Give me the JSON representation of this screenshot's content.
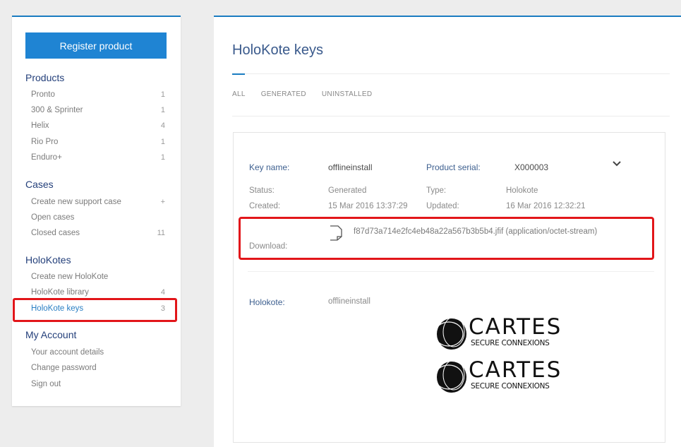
{
  "sidebar": {
    "register_label": "Register product",
    "sections": {
      "products": {
        "title": "Products",
        "items": [
          {
            "label": "Pronto",
            "count": "1"
          },
          {
            "label": "300 & Sprinter",
            "count": "1"
          },
          {
            "label": "Helix",
            "count": "4"
          },
          {
            "label": "Rio Pro",
            "count": "1"
          },
          {
            "label": "Enduro+",
            "count": "1"
          }
        ]
      },
      "cases": {
        "title": "Cases",
        "items": [
          {
            "label": "Create new support case",
            "count": "+"
          },
          {
            "label": "Open cases",
            "count": ""
          },
          {
            "label": "Closed cases",
            "count": "11"
          }
        ]
      },
      "holokotes": {
        "title": "HoloKotes",
        "items": [
          {
            "label": "Create new HoloKote",
            "count": ""
          },
          {
            "label": "HoloKote library",
            "count": "4"
          },
          {
            "label": "HoloKote keys",
            "count": "3"
          }
        ]
      },
      "account": {
        "title": "My Account",
        "items": [
          {
            "label": "Your account details"
          },
          {
            "label": "Change password"
          },
          {
            "label": "Sign out"
          }
        ]
      }
    }
  },
  "main": {
    "title": "HoloKote keys",
    "tabs": [
      "ALL",
      "GENERATED",
      "UNINSTALLED"
    ],
    "key": {
      "key_name_label": "Key name:",
      "key_name": "offlineinstall",
      "serial_label": "Product serial:",
      "serial": "X000003",
      "status_label": "Status:",
      "status": "Generated",
      "type_label": "Type:",
      "type": "Holokote",
      "created_label": "Created:",
      "created": "15 Mar 2016 13:37:29",
      "updated_label": "Updated:",
      "updated": "16 Mar 2016 12:32:21",
      "download_label": "Download:",
      "download_file": "f87d73a714e2fc4eb48a22a567b3b5b4.jfif (application/octet-stream)",
      "holokote_label": "Holokote:",
      "holokote": "offlineinstall"
    },
    "logo": {
      "brand": "CARTES",
      "tagline": "SECURE CONNEXIONS"
    }
  },
  "colors": {
    "accent": "#1f84d3",
    "highlight": "#e2161a",
    "label": "#3d5f8f"
  }
}
